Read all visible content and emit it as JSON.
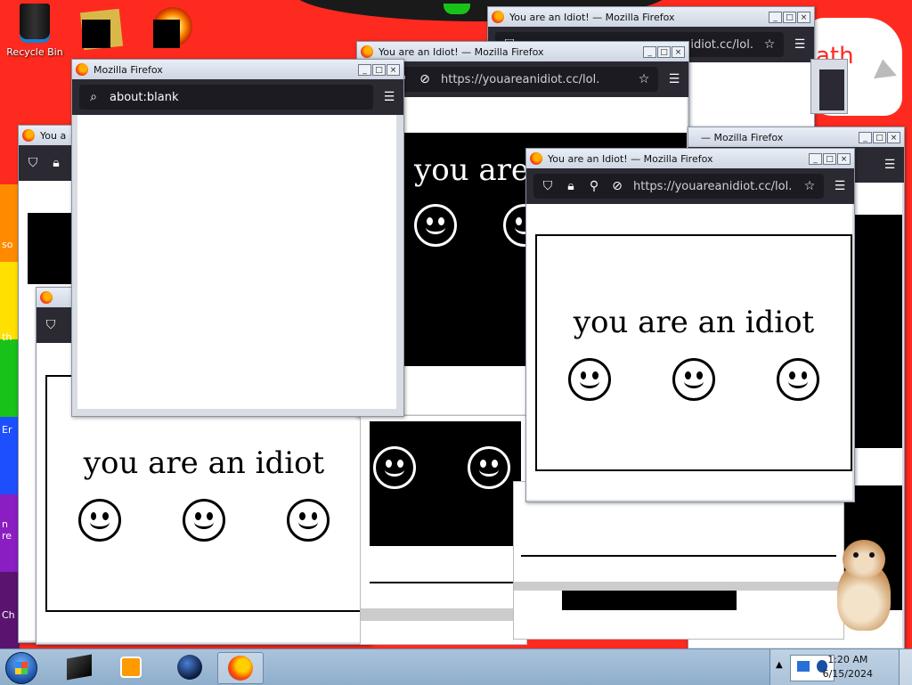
{
  "desktop": {
    "recycle_bin_label": "Recycle Bin",
    "edge_labels": [
      "so",
      "th",
      "Er",
      "n re",
      "Ch"
    ],
    "corner_text": "ath"
  },
  "front_window": {
    "title": "Mozilla Firefox",
    "url": "about:blank"
  },
  "idiot_window": {
    "title": "You are an Idiot! — Mozilla Firefox",
    "title_partial": "You a",
    "url": "https://youareanidiot.cc/lol.",
    "url_partial": "idiot.cc/lol."
  },
  "generic_window": {
    "title_partial": "— Mozilla Firefox"
  },
  "page": {
    "message": "you are an idiot",
    "message_partial": "you are"
  },
  "window_buttons": {
    "minimize": "_",
    "maximize": "□",
    "close": "×"
  },
  "taskbar": {
    "time": "1:20 AM",
    "date": "6/15/2024"
  },
  "colors": {
    "desktop_bg": "#ff2a1f",
    "firefox_toolbar": "#2b2a33",
    "taskbar": "#9fb9d4"
  }
}
